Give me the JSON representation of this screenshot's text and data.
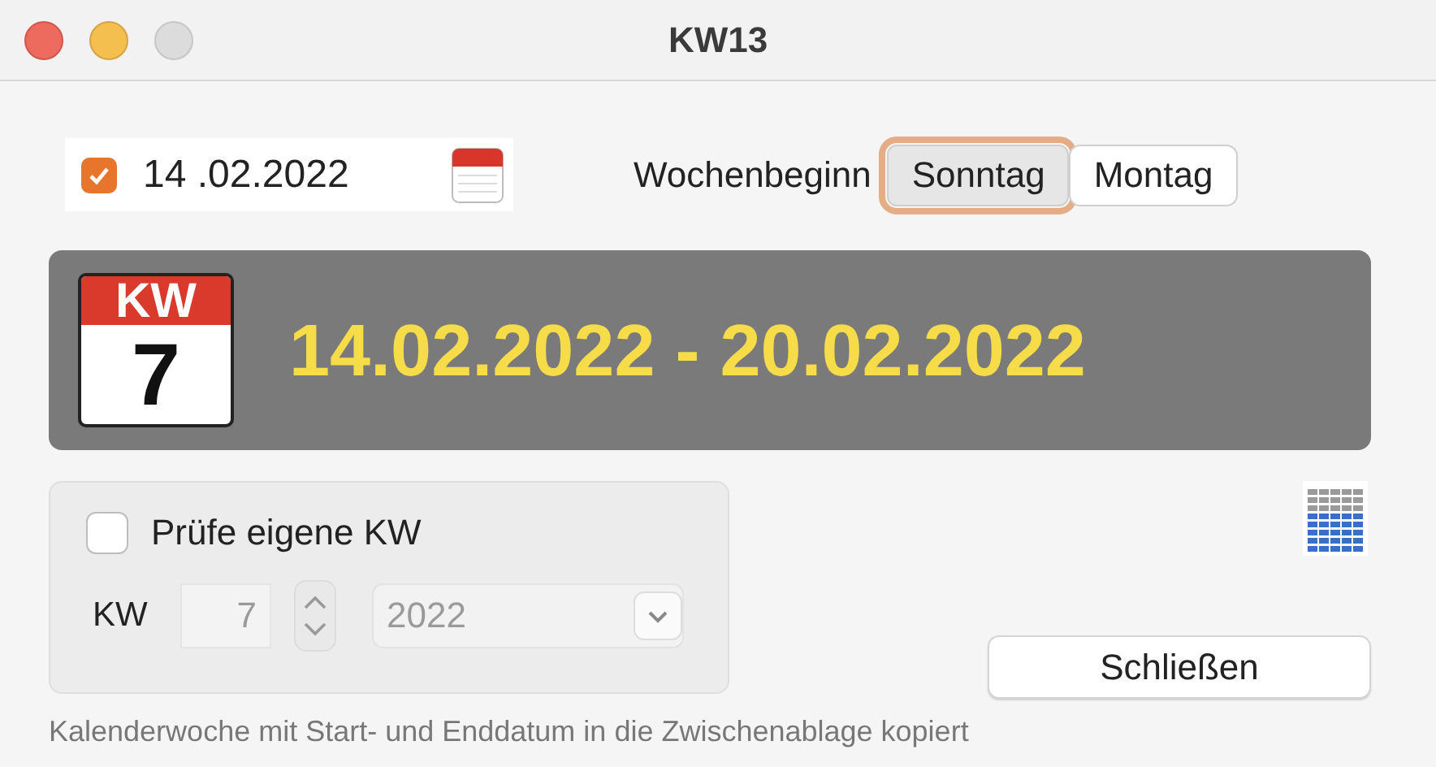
{
  "window": {
    "title": "KW13"
  },
  "date_field": {
    "checked": true,
    "value": "14 .02.2022"
  },
  "week_start": {
    "label": "Wochenbeginn",
    "options": [
      {
        "label": "Sonntag",
        "selected": true
      },
      {
        "label": "Montag",
        "selected": false
      }
    ]
  },
  "banner": {
    "badge_header": "KW",
    "badge_number": "7",
    "range": "14.02.2022 - 20.02.2022"
  },
  "custom_week": {
    "checked": false,
    "label": "Prüfe eigene KW",
    "kw_label": "KW",
    "kw_value": "7",
    "year": "2022",
    "disabled": true
  },
  "close_button": "Schließen",
  "status": "Kalenderwoche mit Start- und Enddatum in die Zwischenablage kopiert"
}
